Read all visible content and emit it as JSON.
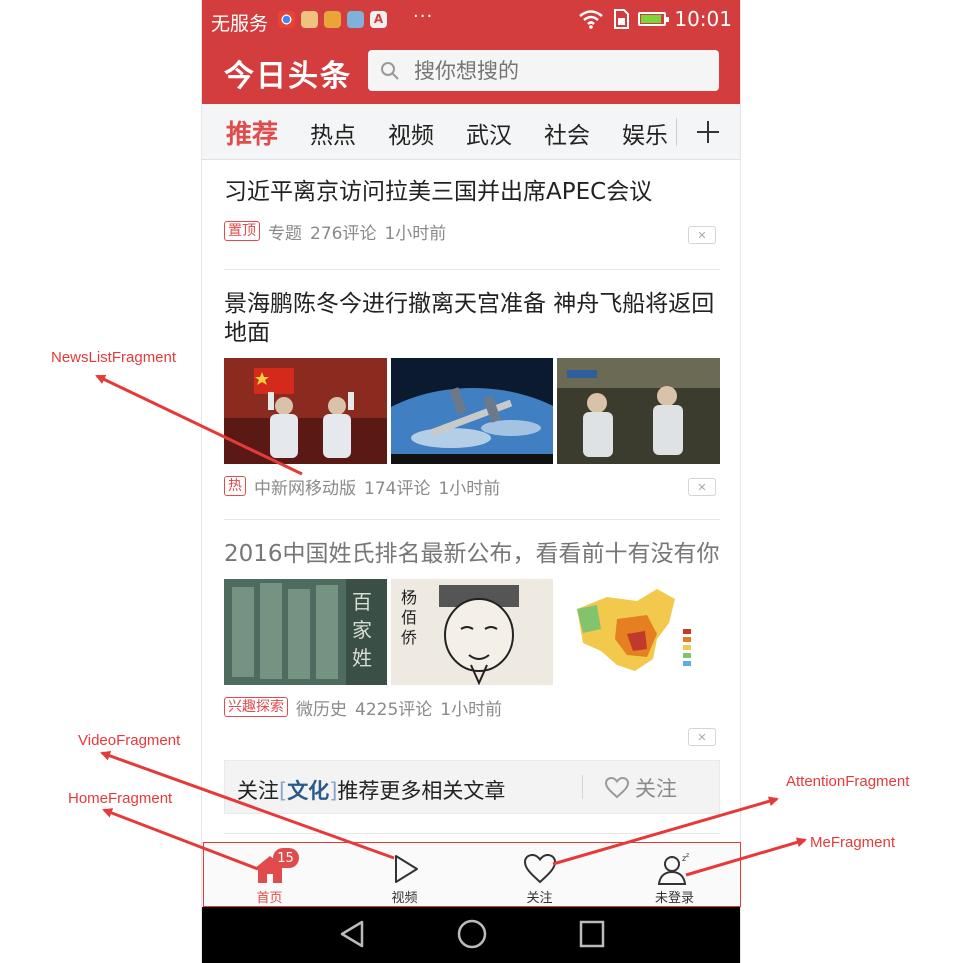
{
  "status_bar": {
    "carrier": "无服务",
    "more": "···",
    "time": "10:01",
    "battery_level": 0.8,
    "app_icon_colors": [
      "#f0f0f0",
      "#f1c27d",
      "#e8a53a",
      "#7fb2d9",
      "#f0f0f0"
    ]
  },
  "header": {
    "logo": "今日头条",
    "search_placeholder": "搜你想搜的"
  },
  "tabs": [
    {
      "label": "推荐",
      "active": true
    },
    {
      "label": "热点",
      "active": false
    },
    {
      "label": "视频",
      "active": false
    },
    {
      "label": "武汉",
      "active": false
    },
    {
      "label": "社会",
      "active": false
    },
    {
      "label": "娱乐",
      "active": false
    }
  ],
  "add_tab_icon": "plus-icon",
  "articles": [
    {
      "title": "习近平离京访问拉美三国并出席APEC会议",
      "tag": "置顶",
      "source": "专题",
      "comments": "276评论",
      "time": "1小时前",
      "read": false
    },
    {
      "title": "景海鹏陈冬今进行撤离天宫准备 神舟飞船将返回地面",
      "tag": "热",
      "source": "中新网移动版",
      "comments": "174评论",
      "time": "1小时前",
      "read": false,
      "images": [
        "astronauts-saluting",
        "spacecraft-over-earth",
        "astronauts-in-capsule"
      ]
    },
    {
      "title": "2016中国姓氏排名最新公布，看看前十有没有你",
      "tag": "兴趣探索",
      "source": "微历史",
      "comments": "4225评论",
      "time": "1小时前",
      "read": true,
      "images": [
        "surname-stone-wall",
        "yang-baiqiao-portrait",
        "china-surname-map"
      ]
    }
  ],
  "follow_bar": {
    "prefix": "关注",
    "open_bracket": "[",
    "topic": "文化",
    "close_bracket": "]",
    "suffix": "推荐更多相关文章",
    "follow_label": "关注",
    "icon": "heart-icon"
  },
  "bottom_nav": [
    {
      "label": "首页",
      "icon": "home-icon",
      "badge": "15",
      "active": true
    },
    {
      "label": "视频",
      "icon": "play-icon",
      "active": false
    },
    {
      "label": "关注",
      "icon": "heart-icon",
      "active": false
    },
    {
      "label": "未登录",
      "icon": "user-icon",
      "active": false
    }
  ],
  "system_nav": [
    "back-icon",
    "home-circle-icon",
    "recents-icon"
  ],
  "annotations": {
    "news_list": "NewsListFragment",
    "video": "VideoFragment",
    "home": "HomeFragment",
    "attention": "AttentionFragment",
    "me": "MeFragment"
  },
  "colors": {
    "brand_red": "#d43d3d",
    "accent_red": "#e04b4b",
    "annotation_red": "#e63a3a"
  }
}
